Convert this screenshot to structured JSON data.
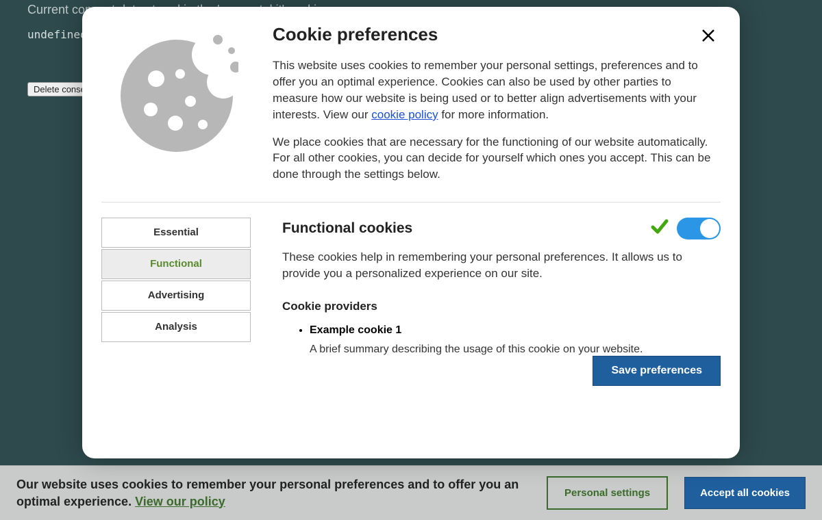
{
  "background": {
    "stored_label": "Current consent data stored in the 'consent_kit' cookie:",
    "value": "undefined",
    "delete_button": "Delete consent data"
  },
  "cookiebar": {
    "message_prefix": "Our website uses cookies to remember your personal preferences and to offer you an optimal experience. ",
    "policy_link": "View our policy",
    "personal_settings": "Personal settings",
    "accept_all": "Accept all cookies"
  },
  "modal": {
    "title": "Cookie preferences",
    "paragraph1_pre": "This website uses cookies to remember your personal settings, preferences and to offer you an optimal experience. Cookies can also be used by other parties to measure how our website is being used or to better align advertisements with your interests. View our ",
    "cookie_policy_link": "cookie policy",
    "paragraph1_post": " for more information.",
    "paragraph2": "We place cookies that are necessary for the functioning of our website automatically. For all other cookies, you can decide for yourself which ones you accept. This can be done through the settings below.",
    "tabs": [
      {
        "label": "Essential"
      },
      {
        "label": "Functional"
      },
      {
        "label": "Advertising"
      },
      {
        "label": "Analysis"
      }
    ],
    "functional": {
      "title": "Functional cookies",
      "description": "These cookies help in remembering your personal preferences. It allows us to provide you a personalized experience on our site.",
      "providers_title": "Cookie providers",
      "providers": [
        {
          "name": "Example cookie 1",
          "desc": "A brief summary describing the usage of this cookie on your website."
        }
      ],
      "enabled": true
    },
    "save": "Save preferences"
  }
}
